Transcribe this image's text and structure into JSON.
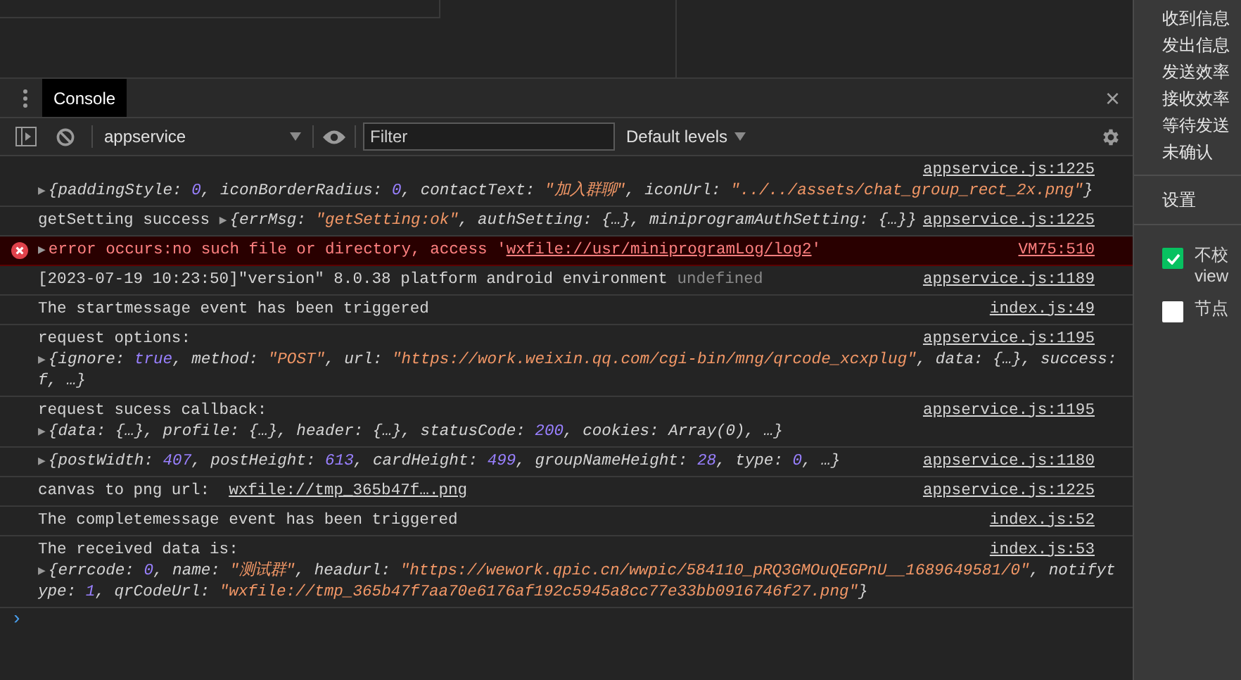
{
  "drawer": {
    "tabs": [
      {
        "label": "Console",
        "selected": true
      }
    ],
    "close": "×"
  },
  "toolbar": {
    "context": "appservice",
    "filter": {
      "placeholder": "Filter"
    },
    "levels": "Default levels"
  },
  "entries": [
    {
      "kind": "log",
      "source": "appservice.js:1225",
      "lines": [
        [
          {
            "kind": "arrow",
            "text": "▶"
          },
          {
            "kind": "obj",
            "text": "{paddingStyle: "
          },
          {
            "kind": "number",
            "text": "0"
          },
          {
            "kind": "obj",
            "text": ", iconBorderRadius: "
          },
          {
            "kind": "number",
            "text": "0"
          },
          {
            "kind": "obj",
            "text": ", contactText: "
          },
          {
            "kind": "string",
            "text": "\"加入群聊\""
          },
          {
            "kind": "obj",
            "text": ", iconUrl: "
          },
          {
            "kind": "string",
            "text": "\"../../assets/chat_group_rect_2x.png\""
          },
          {
            "kind": "obj",
            "text": "}"
          }
        ]
      ]
    },
    {
      "kind": "log",
      "source": "appservice.js:1225",
      "lines": [
        [
          {
            "kind": "text",
            "text": "getSetting success "
          },
          {
            "kind": "arrow",
            "text": "▶"
          },
          {
            "kind": "obj",
            "text": "{errMsg: "
          },
          {
            "kind": "string",
            "text": "\"getSetting:ok\""
          },
          {
            "kind": "obj",
            "text": ", authSetting: {…}, miniprogramAuthSetting: {…}}"
          }
        ]
      ]
    },
    {
      "kind": "error",
      "source": "VM75:510",
      "lines": [
        [
          {
            "kind": "arrow",
            "text": "▶"
          },
          {
            "kind": "text",
            "text": "error occurs:no such file or directory, access '"
          },
          {
            "kind": "link",
            "text": "wxfile://usr/miniprogramLog/log2"
          },
          {
            "kind": "text",
            "text": "'"
          }
        ]
      ]
    },
    {
      "kind": "log",
      "source": "appservice.js:1189",
      "lines": [
        [
          {
            "kind": "text",
            "text": "[2023-07-19 10:23:50]\"version\" 8.0.38 platform android environment "
          },
          {
            "kind": "muted",
            "text": "undefined"
          }
        ]
      ]
    },
    {
      "kind": "log",
      "source": "index.js:49",
      "lines": [
        [
          {
            "kind": "text",
            "text": "The startmessage event has been triggered"
          }
        ]
      ]
    },
    {
      "kind": "log",
      "source": "appservice.js:1195",
      "lines": [
        [
          {
            "kind": "text",
            "text": "request options:"
          }
        ],
        [
          {
            "kind": "arrow",
            "text": "▶"
          },
          {
            "kind": "obj",
            "text": "{ignore: "
          },
          {
            "kind": "number",
            "text": "true"
          },
          {
            "kind": "obj",
            "text": ", method: "
          },
          {
            "kind": "string",
            "text": "\"POST\""
          },
          {
            "kind": "obj",
            "text": ", url: "
          },
          {
            "kind": "string",
            "text": "\"https://work.weixin.qq.com/cgi-bin/mng/qrcode_xcxplug\""
          },
          {
            "kind": "obj",
            "text": ", data: {…}, success:"
          }
        ],
        [
          {
            "kind": "obj",
            "text": "f, …}"
          }
        ]
      ]
    },
    {
      "kind": "log",
      "source": "appservice.js:1195",
      "lines": [
        [
          {
            "kind": "text",
            "text": "request sucess callback:"
          }
        ],
        [
          {
            "kind": "arrow",
            "text": "▶"
          },
          {
            "kind": "obj",
            "text": "{data: {…}, profile: {…}, header: {…}, statusCode: "
          },
          {
            "kind": "number",
            "text": "200"
          },
          {
            "kind": "obj",
            "text": ", cookies: Array(0), …}"
          }
        ]
      ]
    },
    {
      "kind": "log",
      "source": "appservice.js:1180",
      "lines": [
        [
          {
            "kind": "arrow",
            "text": "▶"
          },
          {
            "kind": "obj",
            "text": "{postWidth: "
          },
          {
            "kind": "number",
            "text": "407"
          },
          {
            "kind": "obj",
            "text": ", postHeight: "
          },
          {
            "kind": "number",
            "text": "613"
          },
          {
            "kind": "obj",
            "text": ", cardHeight: "
          },
          {
            "kind": "number",
            "text": "499"
          },
          {
            "kind": "obj",
            "text": ", groupNameHeight: "
          },
          {
            "kind": "number",
            "text": "28"
          },
          {
            "kind": "obj",
            "text": ", type: "
          },
          {
            "kind": "number",
            "text": "0"
          },
          {
            "kind": "obj",
            "text": ", …}"
          }
        ]
      ]
    },
    {
      "kind": "log",
      "source": "appservice.js:1225",
      "lines": [
        [
          {
            "kind": "text",
            "text": "canvas to png url:  "
          },
          {
            "kind": "link",
            "text": "wxfile://tmp_365b47f….png"
          }
        ]
      ]
    },
    {
      "kind": "log",
      "source": "index.js:52",
      "lines": [
        [
          {
            "kind": "text",
            "text": "The completemessage event has been triggered"
          }
        ]
      ]
    },
    {
      "kind": "log",
      "source": "index.js:53",
      "lines": [
        [
          {
            "kind": "text",
            "text": "The received data is:"
          }
        ],
        [
          {
            "kind": "arrow",
            "text": "▶"
          },
          {
            "kind": "obj",
            "text": "{errcode: "
          },
          {
            "kind": "number",
            "text": "0"
          },
          {
            "kind": "obj",
            "text": ", name: "
          },
          {
            "kind": "string",
            "text": "\"测试群\""
          },
          {
            "kind": "obj",
            "text": ", headurl: "
          },
          {
            "kind": "string",
            "text": "\"https://wework.qpic.cn/wwpic/584110_pRQ3GMOuQEGPnU__1689649581/0\""
          },
          {
            "kind": "obj",
            "text": ", notifyt"
          }
        ],
        [
          {
            "kind": "obj",
            "text": "ype: "
          },
          {
            "kind": "number",
            "text": "1"
          },
          {
            "kind": "obj",
            "text": ", qrCodeUrl: "
          },
          {
            "kind": "string",
            "text": "\"wxfile://tmp_365b47f7aa70e6176af192c5945a8cc77e33bb0916746f27.png\""
          },
          {
            "kind": "obj",
            "text": "}"
          }
        ]
      ]
    }
  ],
  "prompt": "›",
  "side_panel": {
    "stats": [
      "收到信息",
      "发出信息",
      "发送效率",
      "接收效率",
      "等待发送",
      "未确认"
    ],
    "settings_title": "设置",
    "options": [
      {
        "lines": [
          "不校",
          "view"
        ],
        "checked": true
      },
      {
        "lines": [
          "节点"
        ],
        "checked": false
      }
    ]
  }
}
